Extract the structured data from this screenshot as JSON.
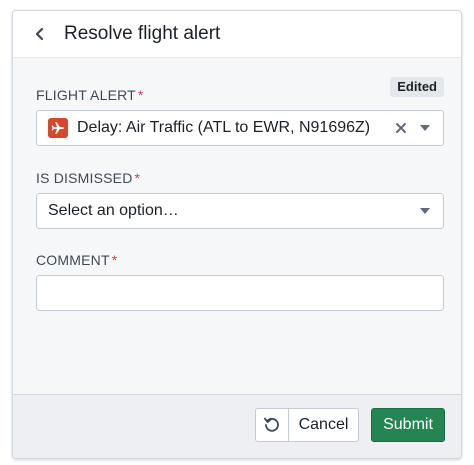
{
  "header": {
    "title": "Resolve flight alert",
    "back_icon": "chevron-left-icon"
  },
  "form": {
    "flight_alert": {
      "label": "FLIGHT ALERT",
      "required_mark": "*",
      "badge": "Edited",
      "value": "Delay: Air Traffic (ATL to EWR, N91696Z)",
      "icon": "airplane-icon",
      "icon_color": "#d9462b"
    },
    "is_dismissed": {
      "label": "IS DISMISSED",
      "required_mark": "*",
      "placeholder": "Select an option…"
    },
    "comment": {
      "label": "COMMENT",
      "required_mark": "*",
      "value": ""
    }
  },
  "footer": {
    "reset_icon": "undo-icon",
    "cancel_label": "Cancel",
    "submit_label": "Submit",
    "submit_color": "#238551"
  }
}
